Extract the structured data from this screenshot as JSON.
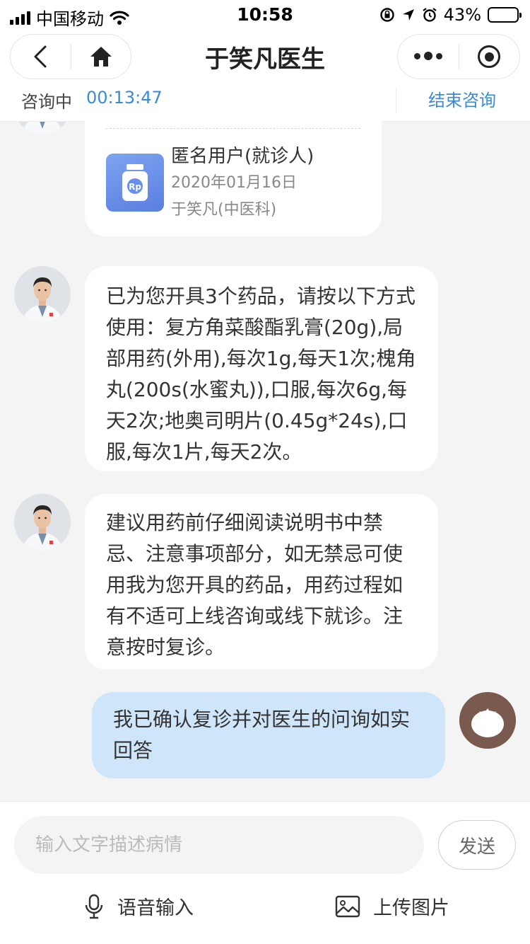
{
  "status_bar": {
    "carrier": "中国移动",
    "time": "10:58",
    "battery": "43%",
    "battery_level": 0.43,
    "icons": [
      "signal-icon",
      "wifi-icon",
      "rotation-lock-icon",
      "location-arrow-icon",
      "alarm-icon",
      "battery-icon"
    ]
  },
  "nav": {
    "title": "于笑凡医生",
    "icons": [
      "back-icon",
      "home-icon",
      "more-icon",
      "target-icon"
    ]
  },
  "consult": {
    "status": "咨询中",
    "timer": "00:13:47",
    "end": "结束咨询"
  },
  "prescription": {
    "patient": "匿名用户(就诊人)",
    "date": "2020年01月16日",
    "doctor": "于笑凡(中医科)",
    "icon_text": "Rp"
  },
  "messages": [
    {
      "from": "doctor",
      "text": "已为您开具3个药品，请按以下方式使用：复方角菜酸酯乳膏(20g),局部用药(外用),每次1g,每天1次;槐角丸(200s(水蜜丸)),口服,每次6g,每天2次;地奥司明片(0.45g*24s),口服,每次1片,每天2次。"
    },
    {
      "from": "doctor",
      "text": "建议用药前仔细阅读说明书中禁忌、注意事项部分，如无禁忌可使用我为您开具的药品，用药过程如有不适可上线咨询或线下就诊。注意按时复诊。"
    },
    {
      "from": "patient",
      "text": "我已确认复诊并对医生的问询如实回答"
    }
  ],
  "input": {
    "placeholder": "输入文字描述病情",
    "send": "发送",
    "voice": "语音输入",
    "upload": "上传图片"
  },
  "colors": {
    "accent": "#3a8ad8",
    "patient_bubble": "#cfe6fa",
    "rx_icon": "#6a8fe8",
    "patient_avatar": "#7a5a4e"
  }
}
